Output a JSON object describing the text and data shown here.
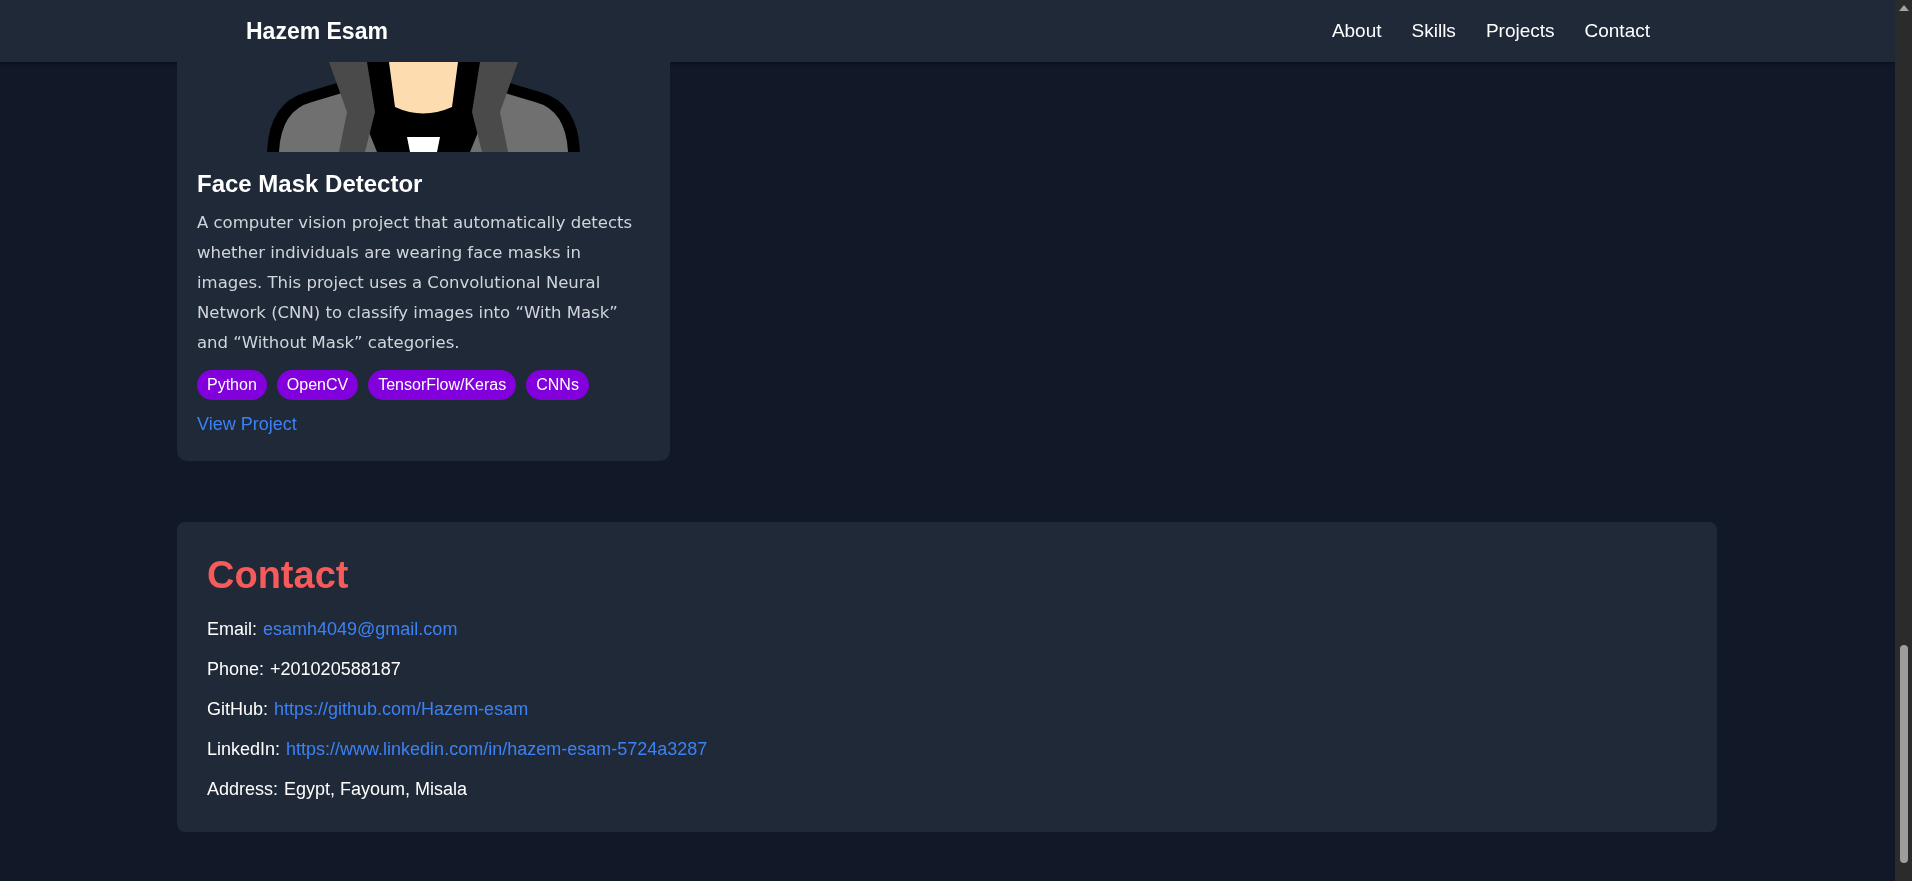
{
  "navbar": {
    "brand": "Hazem Esam",
    "links": [
      "About",
      "Skills",
      "Projects",
      "Contact"
    ]
  },
  "project": {
    "image": {
      "kind": "picture"
    },
    "title": "Face Mask Detector",
    "description": "A computer vision project that automatically detects whether individuals are wearing face masks in images. This project uses a Convolutional Neural Network (CNN) to classify images into “With Mask” and “Without Mask” categories.",
    "tags": [
      "Python",
      "OpenCV",
      "TensorFlow/Keras",
      "CNNs"
    ],
    "link": "View Project"
  },
  "contact": {
    "title": "Contact",
    "items": [
      {
        "label": "Email:",
        "value": "esamh4049@gmail.com",
        "kind": "link"
      },
      {
        "label": "Phone:",
        "value": "+201020588187",
        "kind": "text"
      },
      {
        "label": "GitHub:",
        "value": "https://github.com/Hazem-esam",
        "kind": "link"
      },
      {
        "label": "LinkedIn:",
        "value": "https://www.linkedin.com/in/hazem-esam-5724a3287",
        "kind": "link"
      },
      {
        "label": "Address:",
        "value": "Egypt, Fayoum, Misala",
        "kind": "text"
      }
    ]
  }
}
